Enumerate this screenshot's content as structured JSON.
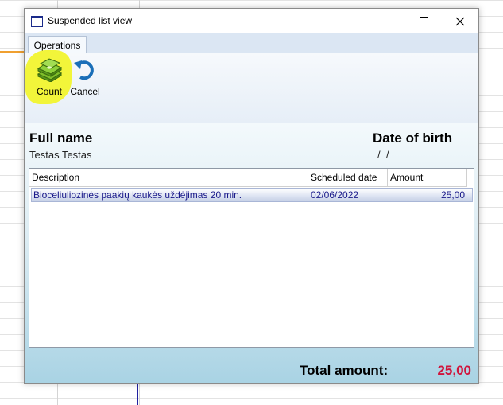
{
  "window": {
    "title": "Suspended list view"
  },
  "ribbon": {
    "tabs": [
      {
        "label": "Operations"
      }
    ],
    "buttons": {
      "count_label": "Count",
      "cancel_label": "Cancel"
    }
  },
  "person": {
    "full_name_label": "Full name",
    "full_name_value": "Testas Testas",
    "dob_label": "Date of birth",
    "dob_value": "/  /"
  },
  "grid": {
    "columns": {
      "description": "Description",
      "scheduled_date": "Scheduled date",
      "amount": "Amount"
    },
    "rows": [
      {
        "description": "Bioceliuliozinės paakių kaukės uždėjimas 20 min.",
        "scheduled_date": "02/06/2022",
        "amount": "25,00"
      }
    ]
  },
  "totals": {
    "label": "Total amount:",
    "value": "25,00"
  },
  "colors": {
    "total_value": "#d0143c",
    "highlight": "#f2f53a",
    "row_text": "#1a1a8a"
  },
  "icons": {
    "count": "money-stack-icon",
    "cancel": "undo-arrow-icon",
    "app": "window-icon"
  }
}
